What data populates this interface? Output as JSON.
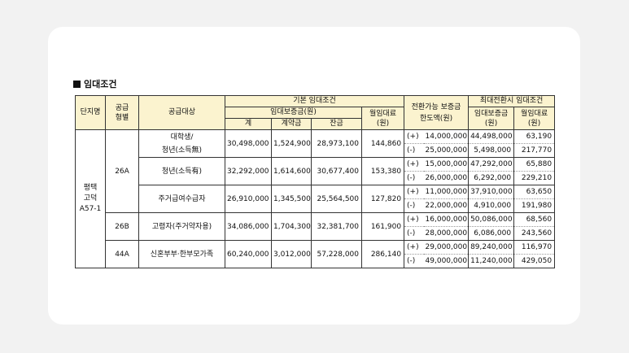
{
  "section_title": "임대조건",
  "headers": {
    "complex": "단지명",
    "supply_type": "공급\n형별",
    "supply_target": "공급대상",
    "basic": "기본  임대조건",
    "deposit": "임대보증금(원)",
    "total": "계",
    "down": "계약금",
    "balance": "잔금",
    "monthly": "월임대료\n(원)",
    "convert": "전환가능  보증금\n한도액(원)",
    "max_convert": "최대전환시  임대조건",
    "max_deposit": "임대보증금\n(원)",
    "max_monthly": "월임대료\n(원)"
  },
  "complex_name": "평택\n고덕\nA57-1",
  "groups": [
    {
      "type": "26A",
      "target": "대학생/\n청년(소득無)",
      "total": "30,498,000",
      "down": "1,524,900",
      "balance": "28,973,100",
      "monthly": "144,860",
      "plus": {
        "sign": "(+)",
        "amount": "14,000,000",
        "deposit": "44,498,000",
        "rent": "63,190"
      },
      "minus": {
        "sign": "(-)",
        "amount": "25,000,000",
        "deposit": "5,498,000",
        "rent": "217,770"
      }
    },
    {
      "type": "",
      "target": "청년(소득有)",
      "total": "32,292,000",
      "down": "1,614,600",
      "balance": "30,677,400",
      "monthly": "153,380",
      "plus": {
        "sign": "(+)",
        "amount": "15,000,000",
        "deposit": "47,292,000",
        "rent": "65,880"
      },
      "minus": {
        "sign": "(-)",
        "amount": "26,000,000",
        "deposit": "6,292,000",
        "rent": "229,210"
      }
    },
    {
      "type": "",
      "target": "주거급여수급자",
      "total": "26,910,000",
      "down": "1,345,500",
      "balance": "25,564,500",
      "monthly": "127,820",
      "plus": {
        "sign": "(+)",
        "amount": "11,000,000",
        "deposit": "37,910,000",
        "rent": "63,650"
      },
      "minus": {
        "sign": "(-)",
        "amount": "22,000,000",
        "deposit": "4,910,000",
        "rent": "191,980"
      }
    },
    {
      "type": "26B",
      "target": "고령자(주거약자용)",
      "total": "34,086,000",
      "down": "1,704,300",
      "balance": "32,381,700",
      "monthly": "161,900",
      "plus": {
        "sign": "(+)",
        "amount": "16,000,000",
        "deposit": "50,086,000",
        "rent": "68,560"
      },
      "minus": {
        "sign": "(-)",
        "amount": "28,000,000",
        "deposit": "6,086,000",
        "rent": "243,560"
      }
    },
    {
      "type": "44A",
      "target": "신혼부부·한부모가족",
      "total": "60,240,000",
      "down": "3,012,000",
      "balance": "57,228,000",
      "monthly": "286,140",
      "plus": {
        "sign": "(+)",
        "amount": "29,000,000",
        "deposit": "89,240,000",
        "rent": "116,970"
      },
      "minus": {
        "sign": "(-)",
        "amount": "49,000,000",
        "deposit": "11,240,000",
        "rent": "429,050"
      }
    }
  ]
}
